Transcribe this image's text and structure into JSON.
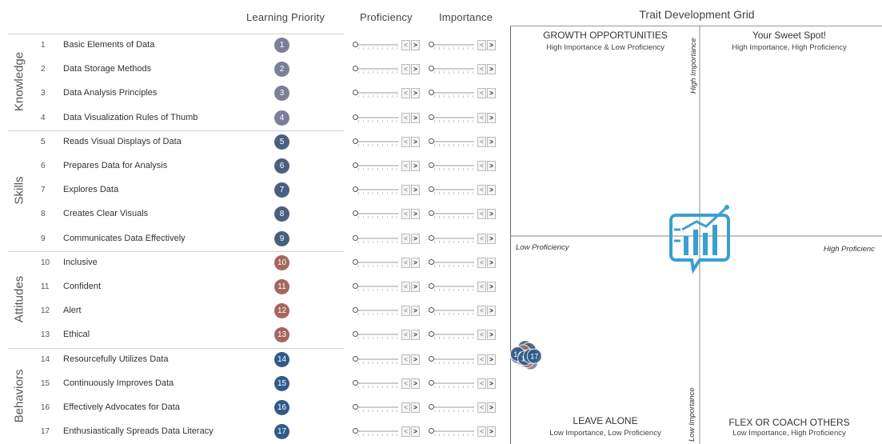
{
  "headers": {
    "learning_priority": "Learning Priority",
    "proficiency": "Proficiency",
    "importance": "Importance"
  },
  "groups": [
    {
      "name": "Knowledge",
      "start": 0,
      "count": 4
    },
    {
      "name": "Skills",
      "start": 4,
      "count": 5
    },
    {
      "name": "Attitudes",
      "start": 9,
      "count": 4
    },
    {
      "name": "Behaviors",
      "start": 13,
      "count": 4
    }
  ],
  "traits": [
    {
      "num": "1",
      "label": "Basic Elements of Data",
      "badge_color": "#7b7f9a"
    },
    {
      "num": "2",
      "label": "Data Storage Methods",
      "badge_color": "#7b7f9a"
    },
    {
      "num": "3",
      "label": "Data Analysis Principles",
      "badge_color": "#7b7f9a"
    },
    {
      "num": "4",
      "label": "Data Visualization Rules of Thumb",
      "badge_color": "#7b7f9a"
    },
    {
      "num": "5",
      "label": "Reads Visual Displays of Data",
      "badge_color": "#4a5f80"
    },
    {
      "num": "6",
      "label": "Prepares Data for Analysis",
      "badge_color": "#4a5f80"
    },
    {
      "num": "7",
      "label": "Explores Data",
      "badge_color": "#4a5f80"
    },
    {
      "num": "8",
      "label": "Creates Clear Visuals",
      "badge_color": "#4a5f80"
    },
    {
      "num": "9",
      "label": "Communicates Data Effectively",
      "badge_color": "#4a5f80"
    },
    {
      "num": "10",
      "label": "Inclusive",
      "badge_color": "#a5675f"
    },
    {
      "num": "11",
      "label": "Confident",
      "badge_color": "#a5675f"
    },
    {
      "num": "12",
      "label": "Alert",
      "badge_color": "#a5675f"
    },
    {
      "num": "13",
      "label": "Ethical",
      "badge_color": "#a5675f"
    },
    {
      "num": "14",
      "label": "Resourcefully Utilizes Data",
      "badge_color": "#2f5a8c"
    },
    {
      "num": "15",
      "label": "Continuously Improves Data",
      "badge_color": "#2f5a8c"
    },
    {
      "num": "16",
      "label": "Effectively Advocates for Data",
      "badge_color": "#2f5a8c"
    },
    {
      "num": "17",
      "label": "Enthusiastically Spreads Data Literacy",
      "badge_color": "#2f5a8c"
    }
  ],
  "slider_buttons": {
    "prev": "<",
    "next": ">"
  },
  "grid": {
    "title": "Trait Development Grid",
    "q_top_left_title": "GROWTH OPPORTUNITIES",
    "q_top_left_sub": "High Importance & Low Proficiency",
    "q_top_right_title": "Your Sweet Spot!",
    "q_top_right_sub": "High Importance, High Proficiency",
    "q_bottom_left_title": "LEAVE ALONE",
    "q_bottom_left_sub": "Low Importance, Low Proficiency",
    "q_bottom_right_title": "FLEX OR COACH OTHERS",
    "q_bottom_right_sub": "Low Importance, High Proficiency",
    "axis_high_importance": "High Importance",
    "axis_low_importance": "Low Importance",
    "axis_low_proficiency": "Low Proficiency",
    "axis_high_proficiency": "High Proficienc",
    "logo_color": "#3a9fd0",
    "logo": "chart-bubble-logo"
  },
  "chart_data": {
    "type": "scatter",
    "title": "Trait Development Grid",
    "xlabel": "Proficiency",
    "ylabel": "Importance",
    "xlim": [
      0,
      1
    ],
    "ylim": [
      0,
      1
    ],
    "points": [
      {
        "label": "1",
        "x": 0.04,
        "y": 0.2,
        "color": "#7b7f9a"
      },
      {
        "label": "2",
        "x": 0.055,
        "y": 0.195,
        "color": "#7b7f9a"
      },
      {
        "label": "3",
        "x": 0.03,
        "y": 0.205,
        "color": "#7b7f9a"
      },
      {
        "label": "4",
        "x": 0.035,
        "y": 0.205,
        "color": "#7b7f9a"
      },
      {
        "label": "5",
        "x": 0.045,
        "y": 0.225,
        "color": "#4a5f80"
      },
      {
        "label": "6",
        "x": 0.04,
        "y": 0.23,
        "color": "#4a5f80"
      },
      {
        "label": "7",
        "x": 0.06,
        "y": 0.215,
        "color": "#4a5f80"
      },
      {
        "label": "8",
        "x": 0.02,
        "y": 0.21,
        "color": "#4a5f80"
      },
      {
        "label": "9",
        "x": 0.05,
        "y": 0.225,
        "color": "#4a5f80"
      },
      {
        "label": "10",
        "x": 0.025,
        "y": 0.215,
        "color": "#a5675f"
      },
      {
        "label": "11",
        "x": 0.045,
        "y": 0.2,
        "color": "#a5675f"
      },
      {
        "label": "12",
        "x": 0.035,
        "y": 0.22,
        "color": "#a5675f"
      },
      {
        "label": "13",
        "x": 0.035,
        "y": 0.205,
        "color": "#a5675f"
      },
      {
        "label": "14",
        "x": 0.02,
        "y": 0.215,
        "color": "#2f5a8c"
      },
      {
        "label": "15",
        "x": 0.04,
        "y": 0.205,
        "color": "#2f5a8c"
      },
      {
        "label": "16",
        "x": 0.055,
        "y": 0.21,
        "color": "#2f5a8c"
      },
      {
        "label": "17",
        "x": 0.065,
        "y": 0.21,
        "color": "#2f5a8c"
      }
    ]
  }
}
